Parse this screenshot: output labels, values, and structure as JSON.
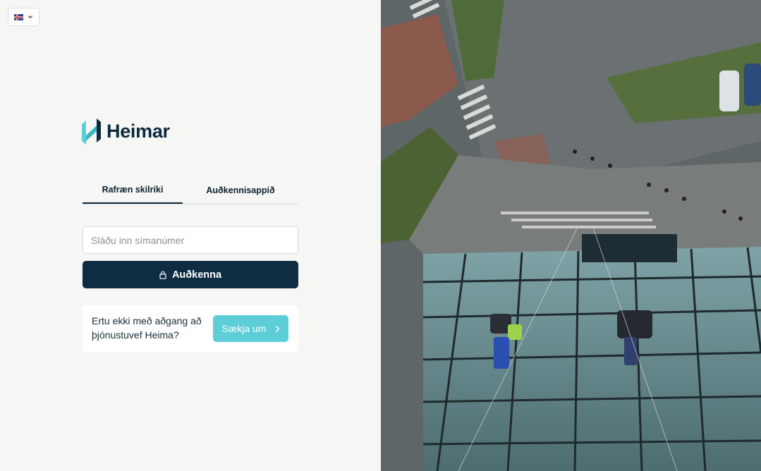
{
  "language": {
    "selected": "Icelandic",
    "flag_icon": "iceland-flag-icon"
  },
  "brand": {
    "name": "Heimar",
    "color": "#0d2a3e",
    "mark_color": "#5dcdd7"
  },
  "tabs": [
    {
      "label": "Rafræn skilríki",
      "active": true
    },
    {
      "label": "Auðkennisappið",
      "active": false
    }
  ],
  "login": {
    "phone_placeholder": "Sláðu inn símanúmer",
    "phone_value": "",
    "submit_label": "Auðkenna",
    "submit_color": "#0e2c42"
  },
  "signup": {
    "prompt": "Ertu ekki með aðgang að þjónustuvef Heima?",
    "button_label": "Sækja um",
    "button_color": "#5dcdd7"
  },
  "hero": {
    "image_name": "aerial-window-cleaners-photo"
  }
}
